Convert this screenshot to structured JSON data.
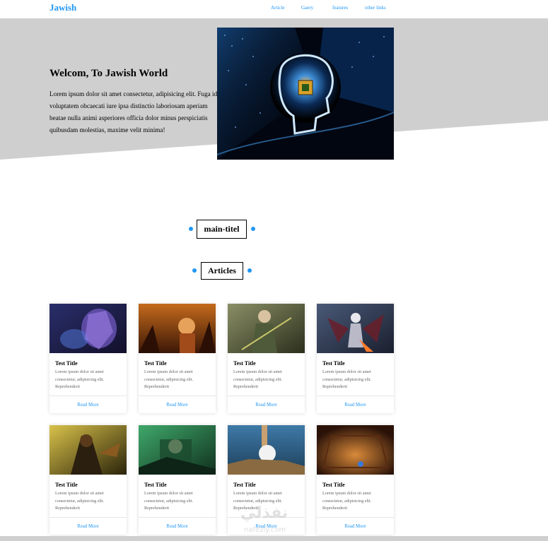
{
  "header": {
    "logo": "Jawish",
    "nav": [
      "Article",
      "Gaery",
      "features",
      "other links"
    ]
  },
  "hero": {
    "title": "Welcom, To Jawish World",
    "text": "Lorem ipsum dolor sit amet consectetur, adipisicing elit. Fuga id voluptatem obcaecati iure ipsa distinctio laboriosam aperiam beatae nulla animi asperiores officia dolor minus perspiciatis quibusdam molestias, maxime velit minima!"
  },
  "sections": {
    "main_title": "main-titel",
    "articles_title": "Articles"
  },
  "cards": [
    {
      "title": "Test Title",
      "text": "Lorem ipsum dolor sit amet consectetur, adipisicing elit. Reprehenderit",
      "link": "Read More"
    },
    {
      "title": "Test Title",
      "text": "Lorem ipsum dolor sit amet consectetur, adipisicing elit. Reprehenderit",
      "link": "Read More"
    },
    {
      "title": "Test Title",
      "text": "Lorem ipsum dolor sit amet consectetur, adipisicing elit. Reprehenderit",
      "link": "Read More"
    },
    {
      "title": "Test Title",
      "text": "Lorem ipsum dolor sit amet consectetur, adipisicing elit. Reprehenderit",
      "link": "Read More"
    },
    {
      "title": "Test Title",
      "text": "Lorem ipsum dolor sit amet consectetur, adipisicing elit. Reprehenderit",
      "link": "Read More"
    },
    {
      "title": "Test Title",
      "text": "Lorem ipsum dolor sit amet consectetur, adipisicing elit. Reprehenderit",
      "link": "Read More"
    },
    {
      "title": "Test Title",
      "text": "Lorem ipsum dolor sit amet consectetur, adipisicing elit. Reprehenderit",
      "link": "Read More"
    },
    {
      "title": "Test Title",
      "text": "Lorem ipsum dolor sit amet consectetur, adipisicing elit. Reprehenderit",
      "link": "Read More"
    }
  ],
  "watermark": {
    "text": "نفذلي",
    "sub": "nafezly.com"
  },
  "colors": {
    "accent": "#2196f3",
    "hero_bg": "#cfcfcf"
  }
}
